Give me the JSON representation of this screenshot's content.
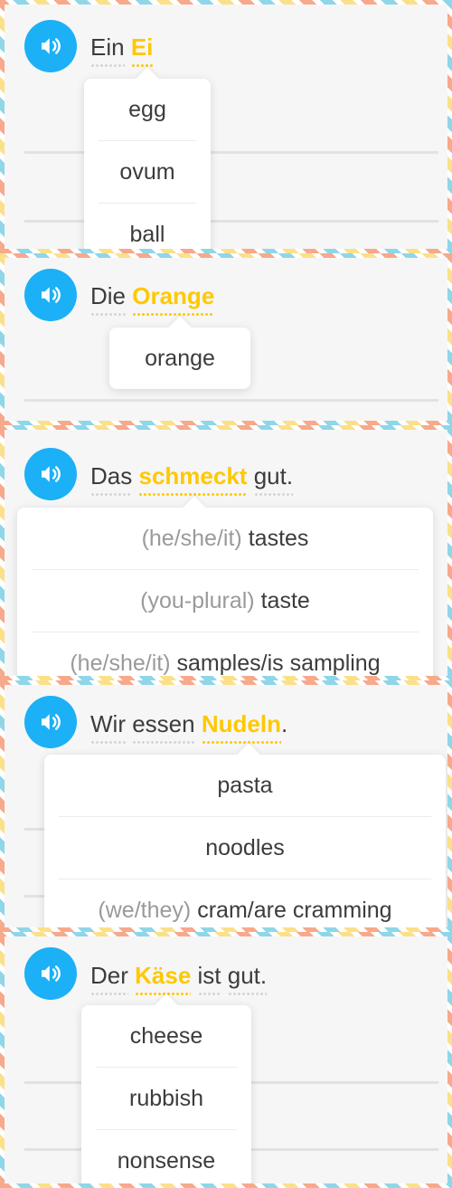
{
  "cards": [
    {
      "sentence": [
        "Ein",
        "Ei"
      ],
      "options": [
        {
          "prefix": "",
          "text": "egg"
        },
        {
          "prefix": "",
          "text": "ovum"
        },
        {
          "prefix": "",
          "text": "ball"
        }
      ]
    },
    {
      "sentence": [
        "Die",
        "Orange"
      ],
      "options": [
        {
          "prefix": "",
          "text": "orange"
        }
      ]
    },
    {
      "sentence": [
        "Das",
        "schmeckt",
        "gut."
      ],
      "options": [
        {
          "prefix": "(he/she/it)",
          "text": "tastes"
        },
        {
          "prefix": "(you-plural)",
          "text": "taste"
        },
        {
          "prefix": "(he/she/it)",
          "text": "samples/is sampling"
        }
      ]
    },
    {
      "sentence": [
        "Wir",
        "essen",
        "Nudeln",
        "."
      ],
      "options": [
        {
          "prefix": "",
          "text": "pasta"
        },
        {
          "prefix": "",
          "text": "noodles"
        },
        {
          "prefix": "(we/they)",
          "text": "cram/are cramming"
        }
      ]
    },
    {
      "sentence": [
        "Der",
        "Käse",
        "ist",
        "gut."
      ],
      "options": [
        {
          "prefix": "",
          "text": "cheese"
        },
        {
          "prefix": "",
          "text": "rubbish"
        },
        {
          "prefix": "",
          "text": "nonsense"
        }
      ]
    }
  ],
  "colors": {
    "accent_blue": "#1cb0f6",
    "highlight": "#ffc800",
    "text": "#3c3c3c",
    "muted": "#9a9a9a"
  },
  "icons": {
    "speaker": "speaker-volume-icon"
  }
}
